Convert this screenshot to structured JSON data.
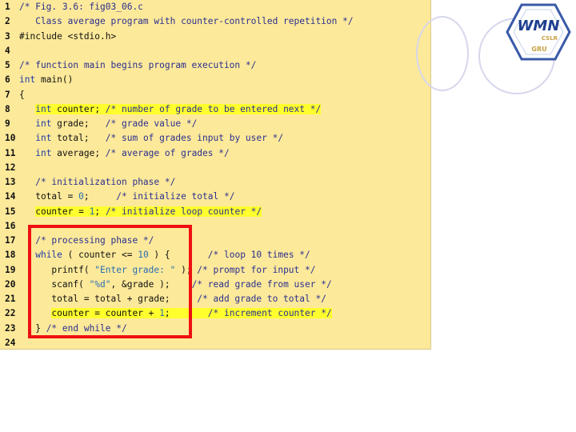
{
  "code": {
    "lines": [
      {
        "num": "1",
        "parts": [
          {
            "t": "/* Fig. 3.6: fig03_06.c",
            "c": "cm"
          }
        ]
      },
      {
        "num": "2",
        "parts": [
          {
            "t": "   Class average program with counter-controlled repetition */",
            "c": "cm"
          }
        ]
      },
      {
        "num": "3",
        "parts": [
          {
            "t": "#include <stdio.h>",
            "c": ""
          }
        ]
      },
      {
        "num": "4",
        "parts": []
      },
      {
        "num": "5",
        "parts": [
          {
            "t": "/* function main begins program execution */",
            "c": "cm"
          }
        ]
      },
      {
        "num": "6",
        "parts": [
          {
            "t": "int",
            "c": "kw"
          },
          {
            "t": " main()",
            "c": ""
          }
        ]
      },
      {
        "num": "7",
        "parts": [
          {
            "t": "{",
            "c": ""
          }
        ]
      },
      {
        "num": "8",
        "parts": [
          {
            "t": "   ",
            "c": ""
          },
          {
            "t": "int",
            "c": "kw hl"
          },
          {
            "t": " counter; ",
            "c": "hl"
          },
          {
            "t": "/* number of grade to be entered next */",
            "c": "cm hl"
          }
        ]
      },
      {
        "num": "9",
        "parts": [
          {
            "t": "   ",
            "c": ""
          },
          {
            "t": "int",
            "c": "kw"
          },
          {
            "t": " grade;   ",
            "c": ""
          },
          {
            "t": "/* grade value */",
            "c": "cm"
          }
        ]
      },
      {
        "num": "10",
        "parts": [
          {
            "t": "   ",
            "c": ""
          },
          {
            "t": "int",
            "c": "kw"
          },
          {
            "t": " total;   ",
            "c": ""
          },
          {
            "t": "/* sum of grades input by user */",
            "c": "cm"
          }
        ]
      },
      {
        "num": "11",
        "parts": [
          {
            "t": "   ",
            "c": ""
          },
          {
            "t": "int",
            "c": "kw"
          },
          {
            "t": " average; ",
            "c": ""
          },
          {
            "t": "/* average of grades */",
            "c": "cm"
          }
        ]
      },
      {
        "num": "12",
        "parts": []
      },
      {
        "num": "13",
        "parts": [
          {
            "t": "   ",
            "c": ""
          },
          {
            "t": "/* initialization phase */",
            "c": "cm"
          }
        ]
      },
      {
        "num": "14",
        "parts": [
          {
            "t": "   total = ",
            "c": ""
          },
          {
            "t": "0",
            "c": "num"
          },
          {
            "t": ";     ",
            "c": ""
          },
          {
            "t": "/* initialize total */",
            "c": "cm"
          }
        ]
      },
      {
        "num": "15",
        "parts": [
          {
            "t": "   ",
            "c": ""
          },
          {
            "t": "counter = ",
            "c": "hl"
          },
          {
            "t": "1",
            "c": "num hl"
          },
          {
            "t": "; ",
            "c": "hl"
          },
          {
            "t": "/* initialize loop counter */",
            "c": "cm hl"
          }
        ]
      },
      {
        "num": "16",
        "parts": []
      },
      {
        "num": "17",
        "parts": [
          {
            "t": "   ",
            "c": ""
          },
          {
            "t": "/* processing phase */",
            "c": "cm"
          }
        ]
      },
      {
        "num": "18",
        "parts": [
          {
            "t": "   ",
            "c": ""
          },
          {
            "t": "while",
            "c": "kw"
          },
          {
            "t": " ( counter <= ",
            "c": ""
          },
          {
            "t": "10",
            "c": "num"
          },
          {
            "t": " ) {       ",
            "c": ""
          },
          {
            "t": "/* loop 10 times */",
            "c": "cm"
          }
        ]
      },
      {
        "num": "19",
        "parts": [
          {
            "t": "      printf( ",
            "c": ""
          },
          {
            "t": "\"Enter grade: \"",
            "c": "str"
          },
          {
            "t": " ); ",
            "c": ""
          },
          {
            "t": "/* prompt for input */",
            "c": "cm"
          }
        ]
      },
      {
        "num": "20",
        "parts": [
          {
            "t": "      scanf( ",
            "c": ""
          },
          {
            "t": "\"%d\"",
            "c": "str"
          },
          {
            "t": ", &grade );    ",
            "c": ""
          },
          {
            "t": "/* read grade from user */",
            "c": "cm"
          }
        ]
      },
      {
        "num": "21",
        "parts": [
          {
            "t": "      total = total + grade;     ",
            "c": ""
          },
          {
            "t": "/* add grade to total */",
            "c": "cm"
          }
        ]
      },
      {
        "num": "22",
        "parts": [
          {
            "t": "      ",
            "c": ""
          },
          {
            "t": "counter = counter + ",
            "c": "hl"
          },
          {
            "t": "1",
            "c": "num hl"
          },
          {
            "t": ";       ",
            "c": "hl"
          },
          {
            "t": "/* increment counter */",
            "c": "cm hl"
          }
        ]
      },
      {
        "num": "23",
        "parts": [
          {
            "t": "   } ",
            "c": ""
          },
          {
            "t": "/* end while */",
            "c": "cm"
          }
        ]
      },
      {
        "num": "24",
        "parts": []
      }
    ]
  },
  "logo": {
    "main_text": "WMN",
    "sub_text": "CSLR",
    "bottom_text": "GRU",
    "colors": {
      "primary": "#1f3f8f",
      "accent": "#c8a040",
      "outline": "#3a5aa8"
    }
  },
  "colors": {
    "panel_bg": "#fde99a",
    "highlight": "#ffff2e",
    "box_border": "#ee1111",
    "comment": "#2a2f8f",
    "keyword": "#1e3aa8"
  }
}
